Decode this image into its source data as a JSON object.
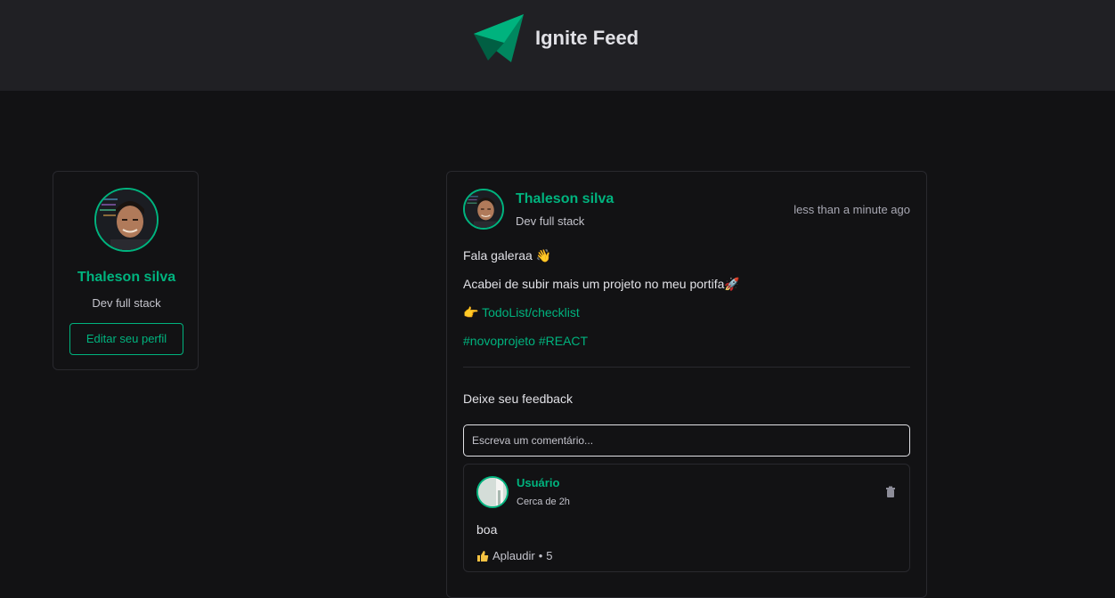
{
  "header": {
    "brand": "Ignite Feed",
    "logo_icon": "ignite-logo"
  },
  "profile": {
    "name": "Thaleson silva",
    "role": "Dev full stack",
    "edit_label": "Editar seu perfil"
  },
  "post": {
    "author": "Thaleson silva",
    "role": "Dev full stack",
    "time": "less than a minute ago",
    "greeting": "Fala galeraa 👋",
    "text": "Acabei de subir mais um projeto no meu portifa🚀",
    "link_emoji": "👉",
    "link_text": "TodoList/checklist",
    "tags": "#novoprojeto #REACT"
  },
  "feedback": {
    "title": "Deixe seu feedback",
    "placeholder": "Escreva um comentário..."
  },
  "comment": {
    "author": "Usuário",
    "time": "Cerca de 2h",
    "text": "boa",
    "applaud_label": "Aplaudir",
    "separator": "•",
    "applaud_count": "5"
  },
  "colors": {
    "accent": "#00b37e",
    "background": "#121214",
    "header": "#202024"
  }
}
